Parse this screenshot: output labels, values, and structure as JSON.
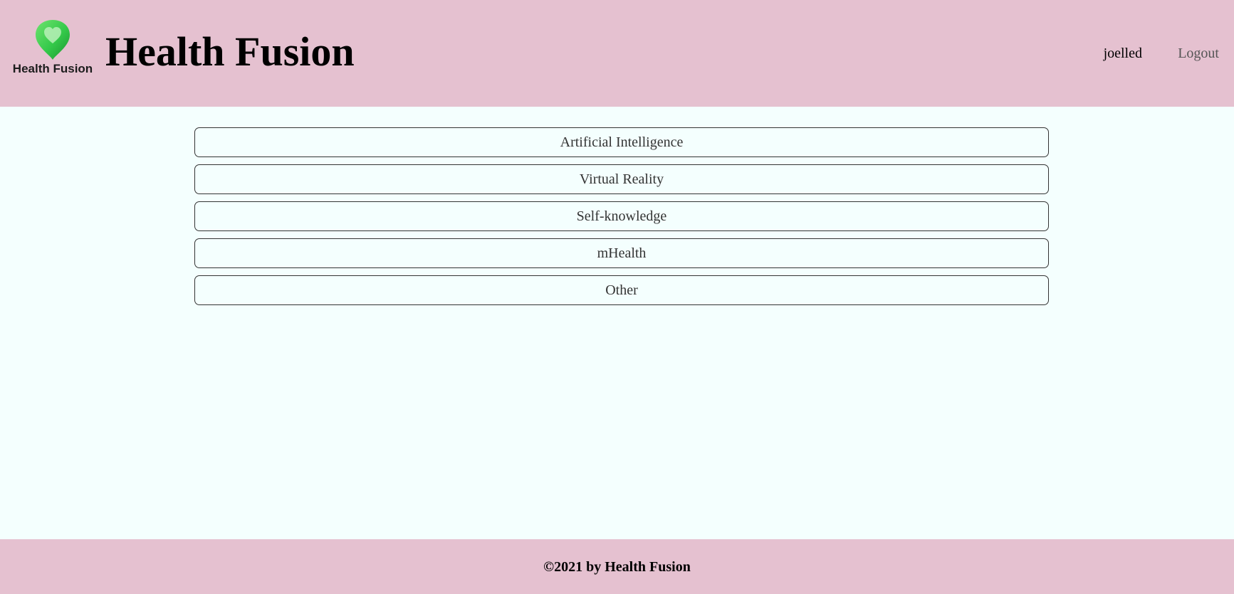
{
  "header": {
    "logo_text": "Health Fusion",
    "title": "Health Fusion",
    "username": "joelled",
    "logout_label": "Logout"
  },
  "topics": [
    {
      "label": "Artificial Intelligence"
    },
    {
      "label": "Virtual Reality"
    },
    {
      "label": "Self-knowledge"
    },
    {
      "label": "mHealth"
    },
    {
      "label": "Other"
    }
  ],
  "footer": {
    "copyright": "©2021 by Health Fusion"
  },
  "colors": {
    "header_bg": "#e5c1d0",
    "page_bg": "#f4fffe",
    "logo_green": "#35c84a",
    "logo_dark_green": "#1e9a32"
  },
  "icons": {
    "logo_mark": "heart-pin-icon"
  }
}
